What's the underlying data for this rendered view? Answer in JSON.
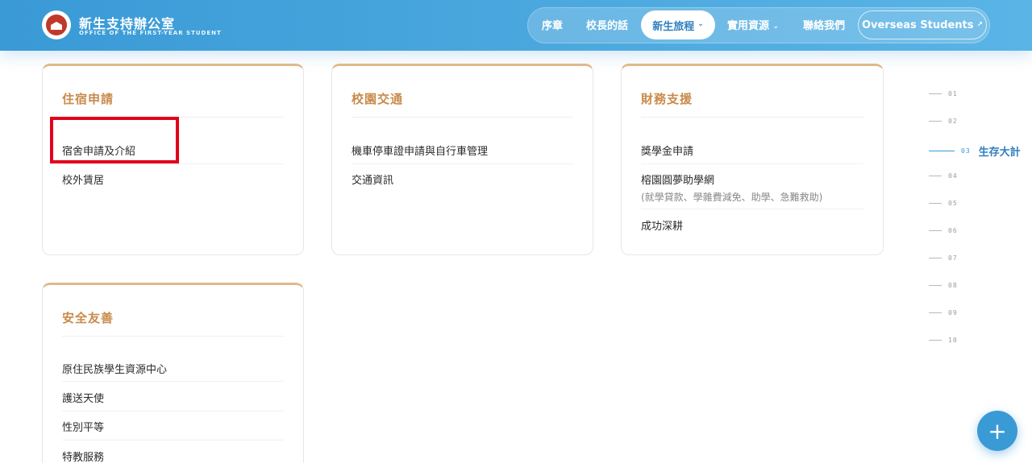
{
  "header": {
    "brand_title": "新生支持辦公室",
    "brand_subtitle": "OFFICE OF THE FIRST-YEAR STUDENT",
    "nav": {
      "prologue": "序章",
      "president": "校長的話",
      "journey": "新生旅程",
      "resources": "實用資源",
      "contact": "聯絡我們",
      "overseas": "Overseas Students",
      "overseas_arrow": "↗",
      "chevron": "⌄"
    }
  },
  "cards": {
    "housing": {
      "title": "住宿申請",
      "items": [
        "宿舍申請及介紹",
        "校外賃居"
      ]
    },
    "transport": {
      "title": "校園交通",
      "items": [
        "機車停車證申請與自行車管理",
        "交通資訊"
      ]
    },
    "finance": {
      "title": "財務支援",
      "items": [
        "獎學金申請",
        "榕園圓夢助學網",
        "成功深耕"
      ],
      "note": "(就學貸款、學雜費減免、助學、急難救助)"
    },
    "safety": {
      "title": "安全友善",
      "items": [
        "原住民族學生資源中心",
        "護送天使",
        "性別平等",
        "特教服務"
      ]
    }
  },
  "side_index": {
    "items": [
      "01",
      "02",
      "03",
      "04",
      "05",
      "06",
      "07",
      "08",
      "09",
      "10"
    ],
    "active_label": "生存大計"
  },
  "fab": {
    "label": "+"
  },
  "colors": {
    "primary": "#3a9ad6",
    "accent": "#c98a4a",
    "highlight": "#e3001b"
  }
}
